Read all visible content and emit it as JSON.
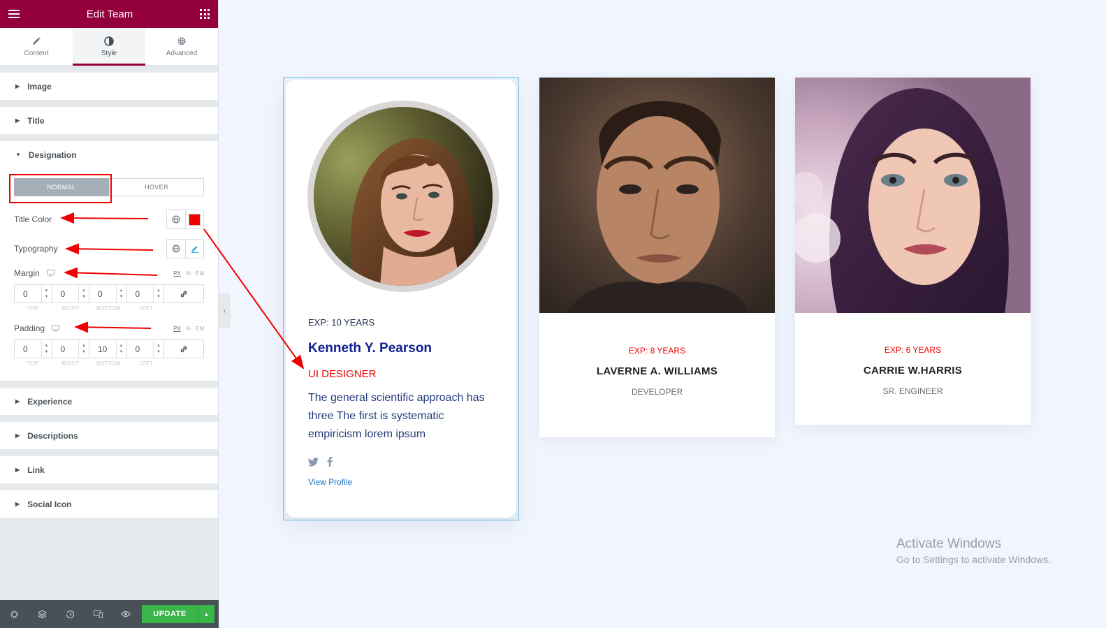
{
  "editor": {
    "title": "Edit Team",
    "tabs": [
      {
        "label": "Content",
        "icon": "pencil-icon"
      },
      {
        "label": "Style",
        "icon": "contrast-icon"
      },
      {
        "label": "Advanced",
        "icon": "gear-icon"
      }
    ],
    "sections_top": [
      "Image",
      "Title",
      "Designation"
    ],
    "designation": {
      "states": [
        "NORMAL",
        "HOVER"
      ],
      "title_color_label": "Title Color",
      "title_color": "#e00000",
      "typography_label": "Typography",
      "margin": {
        "label": "Margin",
        "units": [
          "PX",
          "%",
          "EM"
        ],
        "values": [
          "0",
          "0",
          "0",
          "0"
        ],
        "sides": [
          "TOP",
          "RIGHT",
          "BOTTOM",
          "LEFT"
        ]
      },
      "padding": {
        "label": "Padding",
        "units": [
          "PX",
          "%",
          "EM"
        ],
        "values": [
          "0",
          "0",
          "10",
          "0"
        ],
        "sides": [
          "TOP",
          "RIGHT",
          "BOTTOM",
          "LEFT"
        ]
      }
    },
    "sections_bottom": [
      "Experience",
      "Descriptions",
      "Link",
      "Social Icon"
    ],
    "update_label": "UPDATE",
    "accent_color": "#93003c"
  },
  "cards": {
    "featured": {
      "exp": "EXP: 10 YEARS",
      "name": "Kenneth Y. Pearson",
      "designation": "UI DESIGNER",
      "description": "The general scientific approach has three The first is systematic empiricism lorem ipsum",
      "link": "View Profile"
    },
    "second": {
      "exp": "EXP: 8 YEARS",
      "name": "LAVERNE A. WILLIAMS",
      "designation": "DEVELOPER"
    },
    "third": {
      "exp": "EXP: 6 YEARS",
      "name": "CARRIE W.HARRIS",
      "designation": "SR. ENGINEER"
    }
  },
  "watermark": {
    "line1": "Activate Windows",
    "line2": "Go to Settings to activate Windows."
  }
}
